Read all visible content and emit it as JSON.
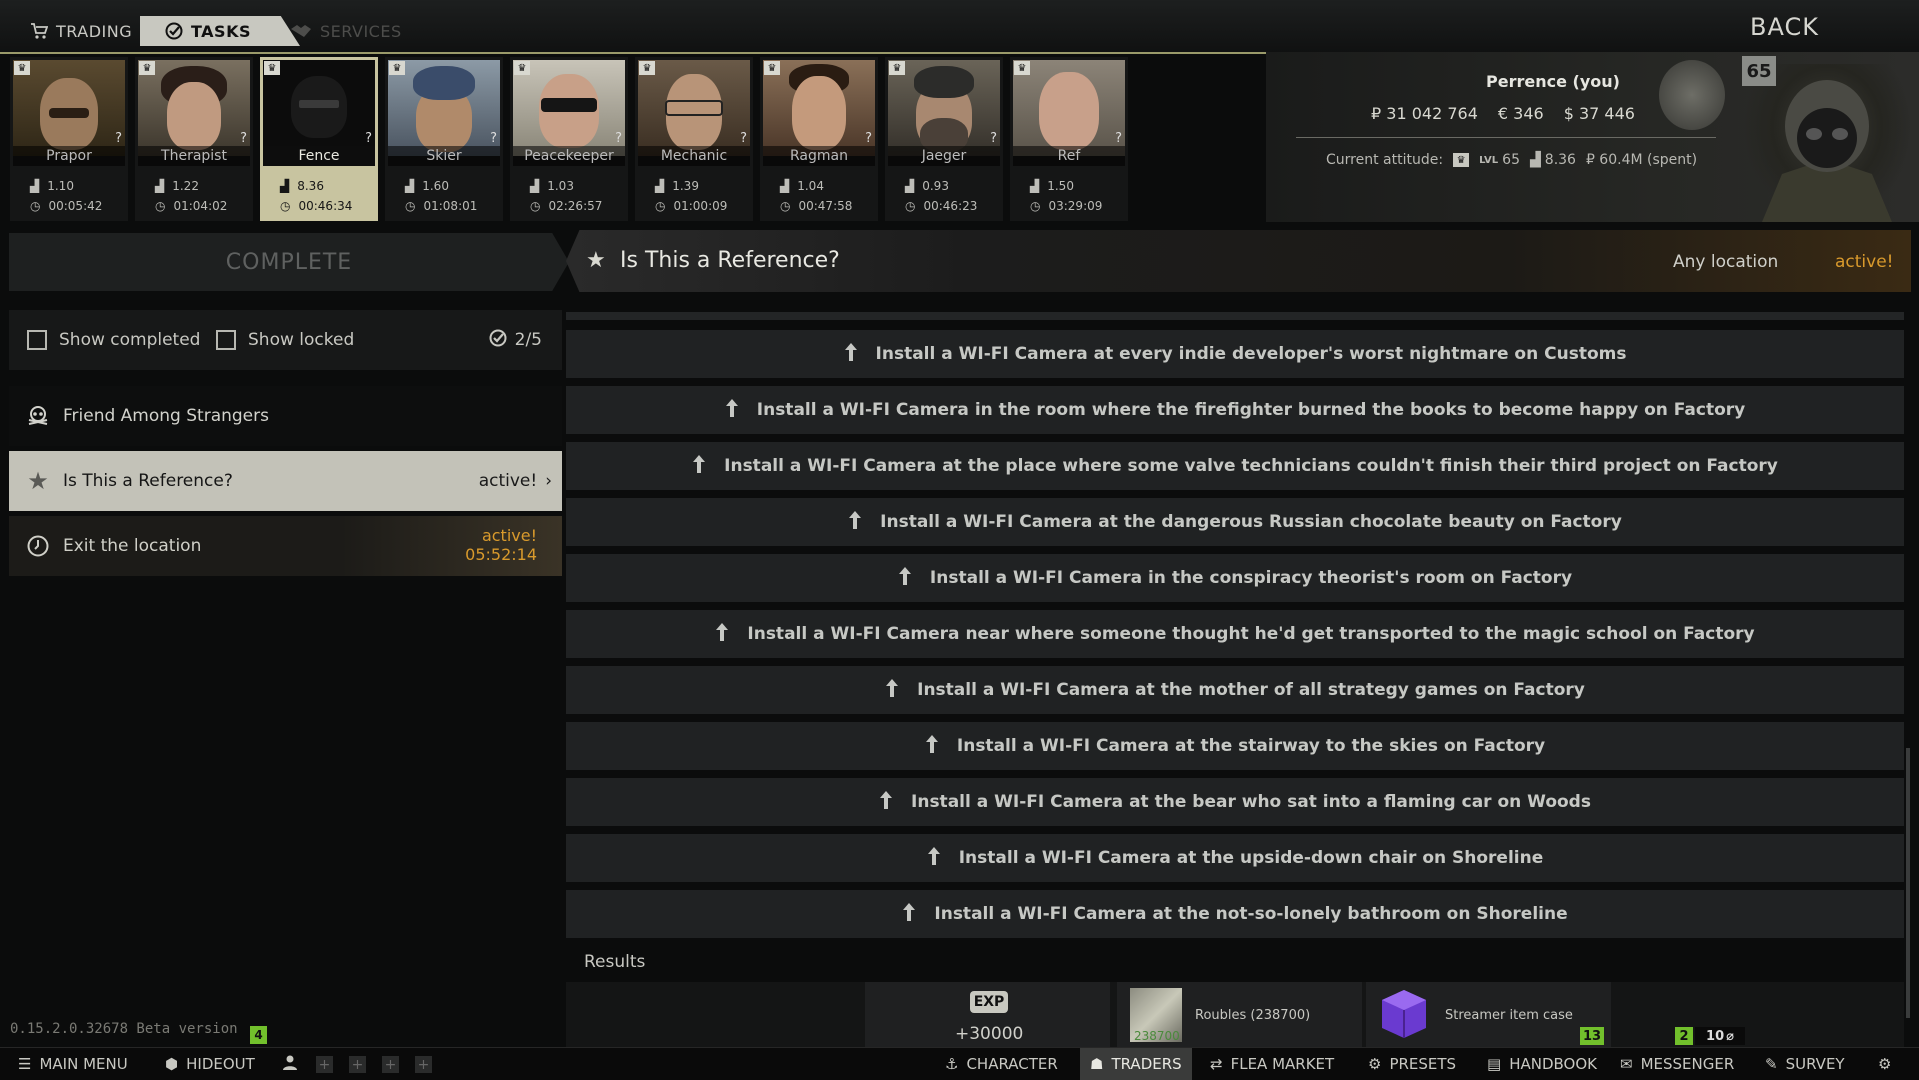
{
  "tabs": {
    "trading": "TRADING",
    "tasks": "TASKS",
    "services": "SERVICES",
    "back": "BACK"
  },
  "traders": [
    {
      "name": "Prapor",
      "rating": "1.10",
      "time": "00:05:42"
    },
    {
      "name": "Therapist",
      "rating": "1.22",
      "time": "01:04:02"
    },
    {
      "name": "Fence",
      "rating": "8.36",
      "time": "00:46:34"
    },
    {
      "name": "Skier",
      "rating": "1.60",
      "time": "01:08:01"
    },
    {
      "name": "Peacekeeper",
      "rating": "1.03",
      "time": "02:26:57"
    },
    {
      "name": "Mechanic",
      "rating": "1.39",
      "time": "01:00:09"
    },
    {
      "name": "Ragman",
      "rating": "1.04",
      "time": "00:47:58"
    },
    {
      "name": "Jaeger",
      "rating": "0.93",
      "time": "00:46:23"
    },
    {
      "name": "Ref",
      "rating": "1.50",
      "time": "03:29:09"
    }
  ],
  "player": {
    "name": "Perrence (you)",
    "roubles": "₽ 31 042 764",
    "euros": "€ 346",
    "dollars": "$ 37 446",
    "attitude_label": "Current attitude:",
    "lvl_label": "LVL",
    "lvl": "65",
    "standing": "8.36",
    "spent": "₽ 60.4M (spent)",
    "level_badge": "65"
  },
  "task": {
    "complete_label": "COMPLETE",
    "title": "Is This a Reference?",
    "location": "Any location",
    "status": "active!"
  },
  "filters": {
    "show_completed": "Show completed",
    "show_locked": "Show locked",
    "count": "2/5"
  },
  "quests": [
    {
      "title": "Friend Among Strangers"
    },
    {
      "title": "Is This a Reference?",
      "status": "active!"
    },
    {
      "title": "Exit the location",
      "status": "active!",
      "timer": "05:52:14"
    }
  ],
  "objectives": [
    "Install a WI-FI Camera at every indie developer's worst nightmare on Customs",
    "Install a WI-FI Camera in the room where the firefighter burned the books to become happy on Factory",
    "Install a WI-FI Camera at the place where some valve technicians couldn't finish their third project on Factory",
    "Install a WI-FI Camera at the dangerous Russian chocolate beauty on Factory",
    "Install a WI-FI Camera in the conspiracy theorist's room on Factory",
    "Install a WI-FI Camera near where someone thought he'd get transported to the magic school on Factory",
    "Install a WI-FI Camera at the mother of all strategy games on Factory",
    "Install a WI-FI Camera at the stairway to the skies on Factory",
    "Install a WI-FI Camera at the bear who sat into a flaming car on Woods",
    "Install a WI-FI Camera at the upside-down chair on Shoreline",
    "Install a WI-FI Camera at the not-so-lonely bathroom on Shoreline"
  ],
  "results": {
    "label": "Results",
    "exp_badge": "EXP",
    "exp_value": "+30000",
    "roubles_label": "Roubles (238700)",
    "roubles_overlay": "238700",
    "case_label": "Streamer item case",
    "case_count": "13",
    "misc_count1": "2",
    "misc_count2": "10"
  },
  "version": {
    "text": "0.15.2.0.32678 Beta version",
    "badge": "4"
  },
  "bottom_bar": {
    "main_menu": "MAIN MENU",
    "hideout": "HIDEOUT",
    "character": "CHARACTER",
    "traders": "TRADERS",
    "flea_market": "FLEA MARKET",
    "presets": "PRESETS",
    "handbook": "HANDBOOK",
    "messenger": "MESSENGER",
    "survey": "SURVEY"
  },
  "colors": {
    "accent_orange": "#d99a2c",
    "badge_green": "#72c02c",
    "selected_row": "#c3c2b8"
  }
}
